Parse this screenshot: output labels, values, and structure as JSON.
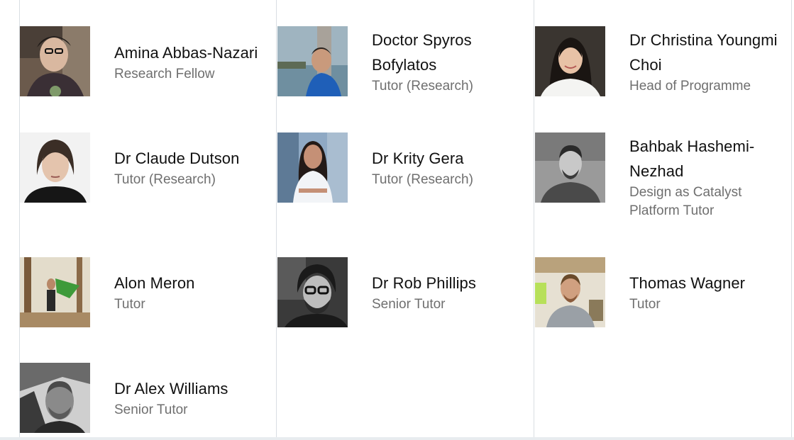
{
  "people": [
    {
      "name": "Amina Abbas-Nazari",
      "role": "Research Fellow",
      "photo_icon": "person-photo-icon"
    },
    {
      "name": "Doctor Spyros Bofylatos",
      "role": "Tutor (Research)",
      "photo_icon": "person-photo-icon"
    },
    {
      "name": "Dr Christina Youngmi Choi",
      "role": "Head of Programme",
      "photo_icon": "person-photo-icon"
    },
    {
      "name": "Dr Claude Dutson",
      "role": "Tutor (Research)",
      "photo_icon": "person-photo-icon"
    },
    {
      "name": "Dr Krity Gera",
      "role": "Tutor (Research)",
      "photo_icon": "person-photo-icon"
    },
    {
      "name": "Bahbak Hashemi-Nezhad",
      "role": "Design as Catalyst Platform Tutor",
      "photo_icon": "person-photo-icon"
    },
    {
      "name": "Alon Meron",
      "role": "Tutor",
      "photo_icon": "person-photo-icon"
    },
    {
      "name": "Dr Rob Phillips",
      "role": "Senior Tutor",
      "photo_icon": "person-photo-icon"
    },
    {
      "name": "Thomas Wagner",
      "role": "Tutor",
      "photo_icon": "person-photo-icon"
    },
    {
      "name": "Dr Alex Williams",
      "role": "Senior Tutor",
      "photo_icon": "person-photo-icon"
    }
  ]
}
